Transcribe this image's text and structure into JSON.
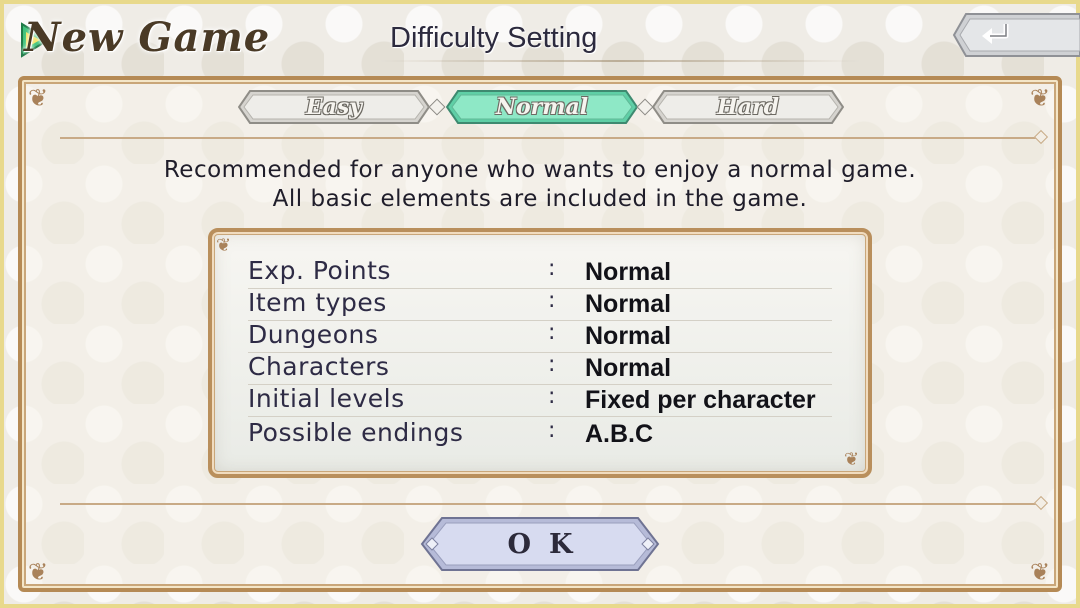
{
  "header": {
    "title": "New Game",
    "subtitle": "Difficulty Setting",
    "back_icon": "return-arrow-icon"
  },
  "tabs": [
    {
      "label": "Easy",
      "selected": false
    },
    {
      "label": "Normal",
      "selected": true
    },
    {
      "label": "Hard",
      "selected": false
    }
  ],
  "description": {
    "line1": "Recommended for anyone who wants to enjoy a normal game.",
    "line2": "All basic elements are included in the game."
  },
  "settings": [
    {
      "label": "Exp. Points",
      "separator": ":",
      "value": "Normal"
    },
    {
      "label": "Item types",
      "separator": ":",
      "value": "Normal"
    },
    {
      "label": "Dungeons",
      "separator": ":",
      "value": "Normal"
    },
    {
      "label": "Characters",
      "separator": ":",
      "value": "Normal"
    },
    {
      "label": "Initial levels",
      "separator": ":",
      "value": "Fixed per character"
    },
    {
      "label": "Possible endings",
      "separator": ":",
      "value": "A.B.C"
    }
  ],
  "ok_button": {
    "label": "OK"
  },
  "colors": {
    "selected_tab": "#7fe0bf",
    "frame": "#b58a55",
    "ok_button": "#c9cde8"
  }
}
